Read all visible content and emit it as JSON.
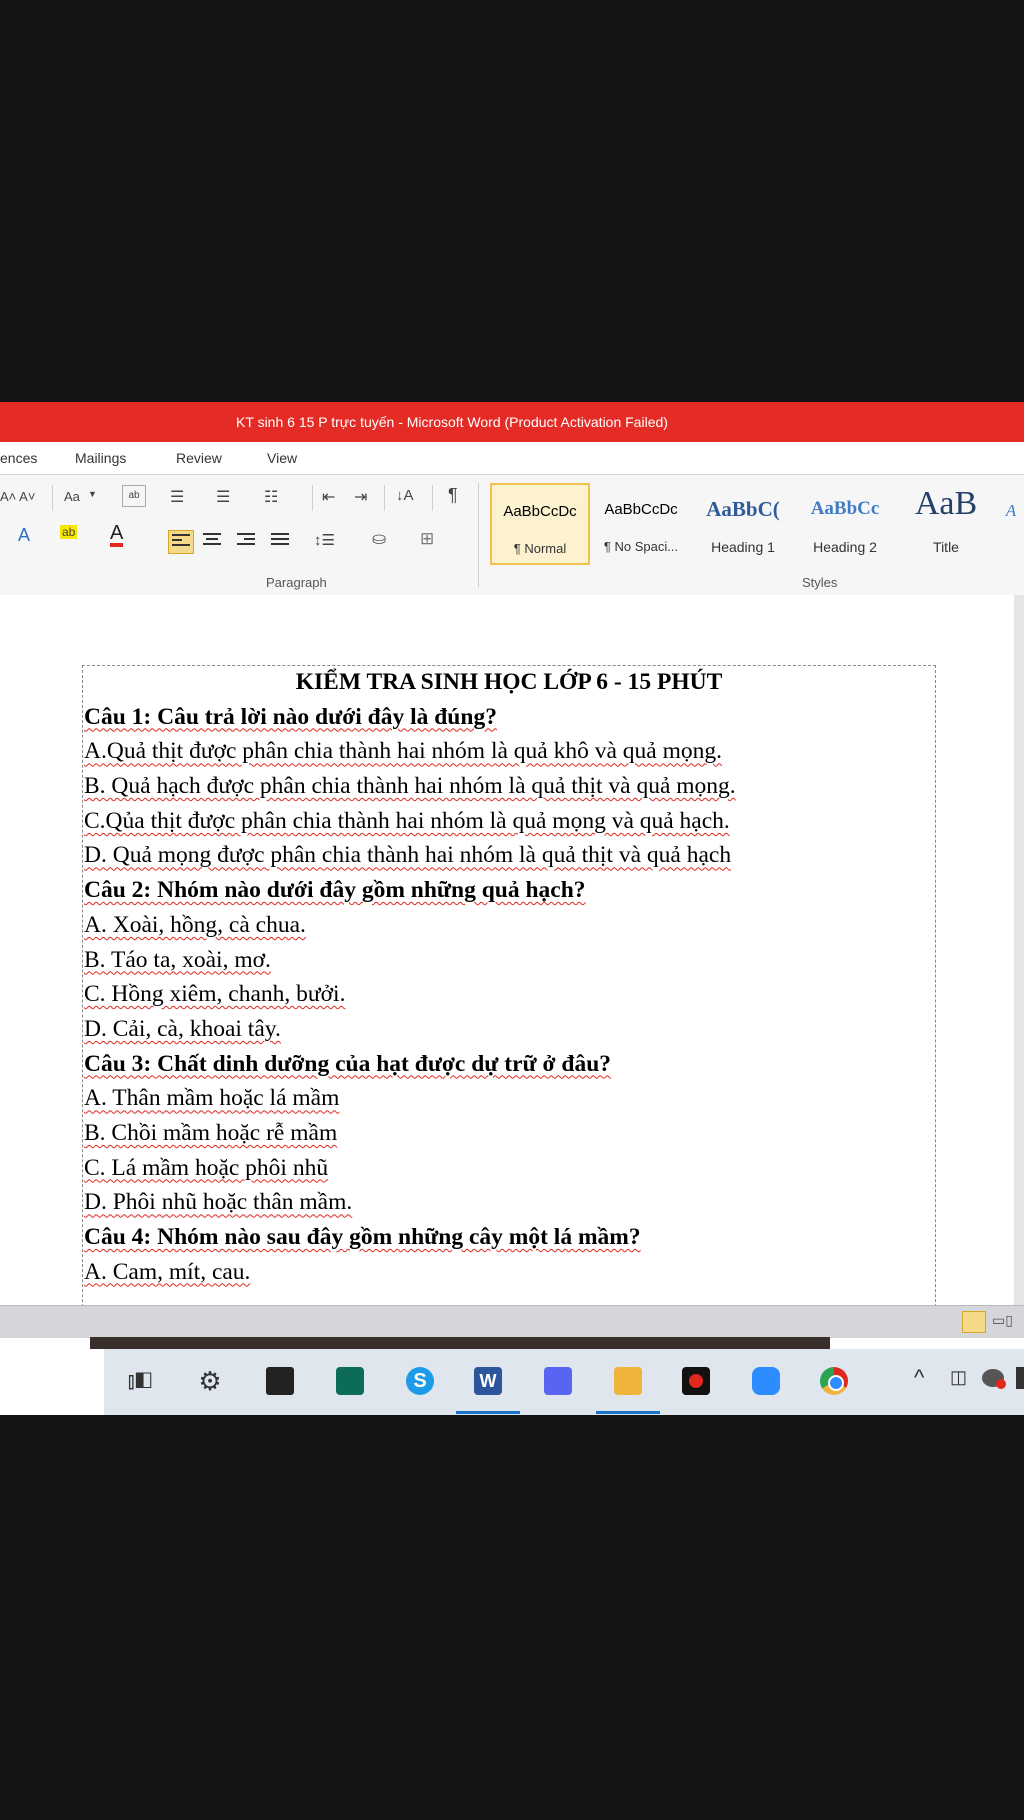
{
  "window": {
    "title": "KT sinh 6 15 P trực tuyến  -  Microsoft Word (Product Activation Failed)"
  },
  "tabs": [
    "ences",
    "Mailings",
    "Review",
    "View"
  ],
  "ribbon": {
    "groups": {
      "paragraph": "Paragraph",
      "styles": "Styles"
    },
    "font_size_label": "Aa",
    "styles": [
      {
        "sample": "AaBbCcDc",
        "name": "¶ Normal"
      },
      {
        "sample": "AaBbCcDc",
        "name": "¶ No Spaci..."
      },
      {
        "sample": "AaBbC(",
        "name": "Heading 1"
      },
      {
        "sample": "AaBbCc",
        "name": "Heading 2"
      },
      {
        "sample": "AaB",
        "name": "Title"
      },
      {
        "sample": "A",
        "name": ""
      }
    ]
  },
  "document": {
    "title": "KIỂM TRA SINH HỌC LỚP 6  - 15 PHÚT",
    "lines": [
      {
        "text": "Câu 1: Câu trả lời nào dưới đây là đúng?",
        "kind": "q"
      },
      {
        "text": "A.Quả thịt được phân chia thành hai nhóm là quả khô và quả mọng.",
        "kind": "a"
      },
      {
        "text": "B. Quả hạch được phân chia thành hai nhóm là quả thịt và quả mọng.",
        "kind": "a"
      },
      {
        "text": "C.Qủa thịt được phân chia thành hai nhóm là quả mọng và quả hạch.",
        "kind": "a"
      },
      {
        "text": "D. Quả mọng được phân chia thành hai nhóm là quả thịt và quả hạch",
        "kind": "a"
      },
      {
        "text": "Câu 2: Nhóm nào dưới đây gồm những quả hạch?",
        "kind": "q"
      },
      {
        "text": "A. Xoài, hồng, cà chua.",
        "kind": "a"
      },
      {
        "text": "B. Táo ta, xoài, mơ.",
        "kind": "a"
      },
      {
        "text": "C. Hồng xiêm, chanh, bưởi.",
        "kind": "a"
      },
      {
        "text": "D. Cải, cà, khoai tây.",
        "kind": "a"
      },
      {
        "text": "Câu 3: Chất dinh dưỡng của hạt được dự trữ ở đâu?",
        "kind": "q"
      },
      {
        "text": "A. Thân mầm hoặc lá mầm",
        "kind": "a"
      },
      {
        "text": "B.  Chồi mầm hoặc rễ mầm",
        "kind": "a"
      },
      {
        "text": "C. Lá mầm hoặc phôi nhũ",
        "kind": "a"
      },
      {
        "text": "D.  Phôi nhũ hoặc thân mầm.",
        "kind": "a"
      },
      {
        "text": "Câu 4: Nhóm nào sau đây gồm những cây một lá  mầm?",
        "kind": "q"
      },
      {
        "text": "A. Cam, mít, cau.",
        "kind": "a"
      }
    ]
  },
  "taskbar": {
    "icons": [
      "task-view-icon",
      "settings-icon",
      "store-icon",
      "power-automate-icon",
      "skype-icon",
      "word-icon",
      "discord-icon",
      "file-explorer-icon",
      "garena-icon",
      "zoom-icon",
      "chrome-icon"
    ],
    "colors": {
      "skype": "#1e9be8",
      "word": "#2b579a",
      "discord": "#5865f2",
      "zoom": "#2d8cff",
      "garena": "#e0281e",
      "folder": "#f2b33d"
    }
  }
}
